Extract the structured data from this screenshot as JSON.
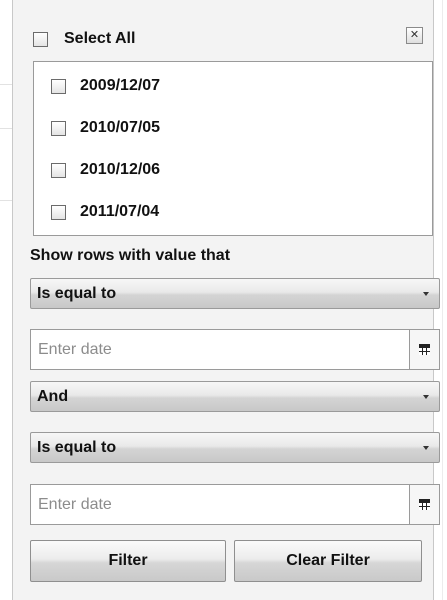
{
  "header": {
    "select_all_label": "Select All",
    "close_symbol": "✕"
  },
  "values_list": {
    "items": [
      {
        "label": "2009/12/07",
        "checked": false
      },
      {
        "label": "2010/07/05",
        "checked": false
      },
      {
        "label": "2010/12/06",
        "checked": false
      },
      {
        "label": "2011/07/04",
        "checked": false
      }
    ]
  },
  "condition": {
    "section_label": "Show rows with value that",
    "first_operator": "Is equal to",
    "first_value_placeholder": "Enter date",
    "first_value": "",
    "logic_operator": "And",
    "second_operator": "Is equal to",
    "second_value_placeholder": "Enter date",
    "second_value": ""
  },
  "actions": {
    "filter_label": "Filter",
    "clear_filter_label": "Clear Filter"
  },
  "icons": {
    "calendar": "calendar-icon",
    "dropdown": "chevron-down-icon",
    "close": "close-icon",
    "checkbox": "checkbox-icon"
  },
  "colors": {
    "panel_background": "#f3f3f3",
    "border": "#9a9a9a",
    "text": "#111111",
    "placeholder": "#8c8c8c"
  }
}
